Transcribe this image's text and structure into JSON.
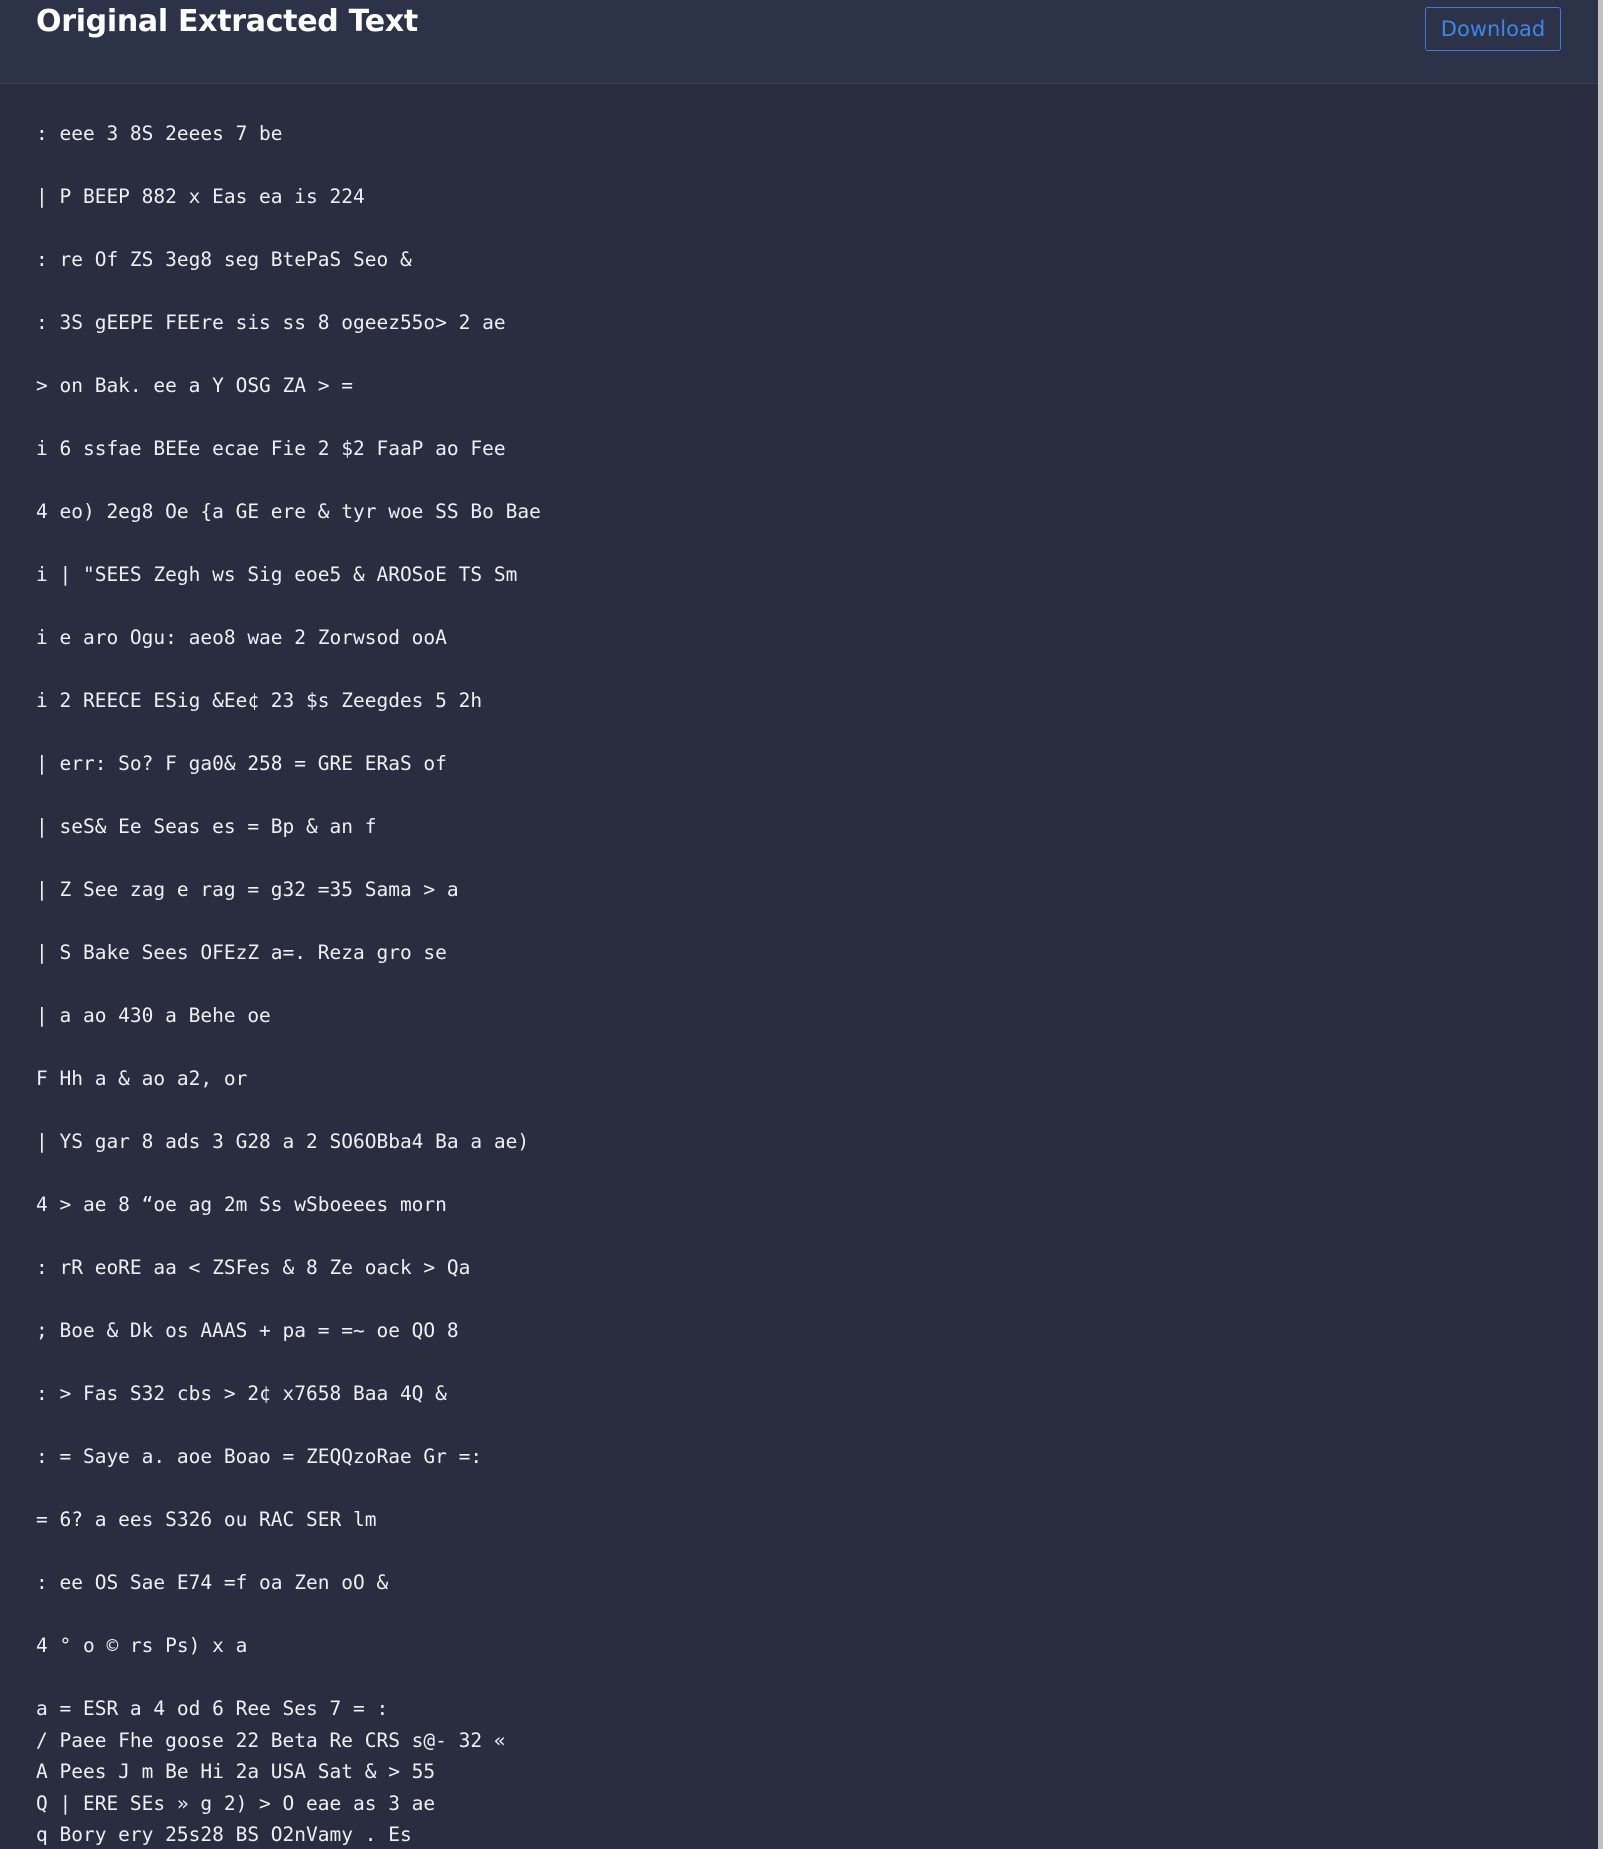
{
  "header": {
    "title": "Original Extracted Text",
    "download_label": "Download"
  },
  "text_lines": [
    ": eee 3 8S 2eees 7 be",
    "| P BEEP 882 x Eas ea is 224",
    ": re Of ZS 3eg8 seg BtePaS Seo &",
    ": 3S gEEPE FEEre sis ss 8 ogeez55o> 2 ae",
    "> on Bak. ee a Y OSG ZA > =",
    "i 6 ssfae BEEe ecae Fie 2 $2 FaaP ao Fee",
    "4 eo) 2eg8 Oe {a GE ere & tyr woe SS Bo Bae",
    "i | \"SEES Zegh ws Sig eoe5 & AROSoE TS Sm",
    "i e aro Ogu: aeo8 wae 2 Zorwsod ooA",
    "i 2 REECE ESig &Ee¢ 23 $s Zeegdes 5 2h",
    "| err: So? F ga0& 258 = GRE ERaS of",
    "| seS& Ee Seas es = Bp & an f",
    "| Z See zag e rag = g32 =35 Sama > a",
    "| S Bake Sees OFEzZ a=. Reza gro se",
    "| a ao 430 a Behe oe",
    "F Hh a & ao a2, or",
    "| YS gar 8 ads 3 G28 a 2 SO6OBba4 Ba a ae)",
    "4 > ae 8 “oe ag 2m Ss wSboeees morn",
    ": rR eoRE aa < ZSFes & 8 Ze oack > Qa",
    "; Boe & Dk os AAAS + pa = =~ oe QO 8",
    ": > Fas S32 cbs > 2¢ x7658 Baa 4Q &",
    ": = Saye a. aoe Boao = ZEQQzoRae Gr =:",
    "= 6? a ees S326 ou RAC SER lm",
    ": ee OS Sae E74 =f oa Zen oO &",
    "4 ° o © rs Ps) x a",
    "a = ESR a 4 od 6 Ree Ses 7 = :",
    "/ Paee Fhe goose 22 Beta Re CRS s@- 32 «",
    "A Pees J m Be Hi 2a USA Sat & > 55",
    "Q | ERE SEs » g 2) > O eae as 3 ae",
    "q Bory ery 25s28 BS O2nVamy . Es"
  ],
  "spaced_line_count": 25
}
